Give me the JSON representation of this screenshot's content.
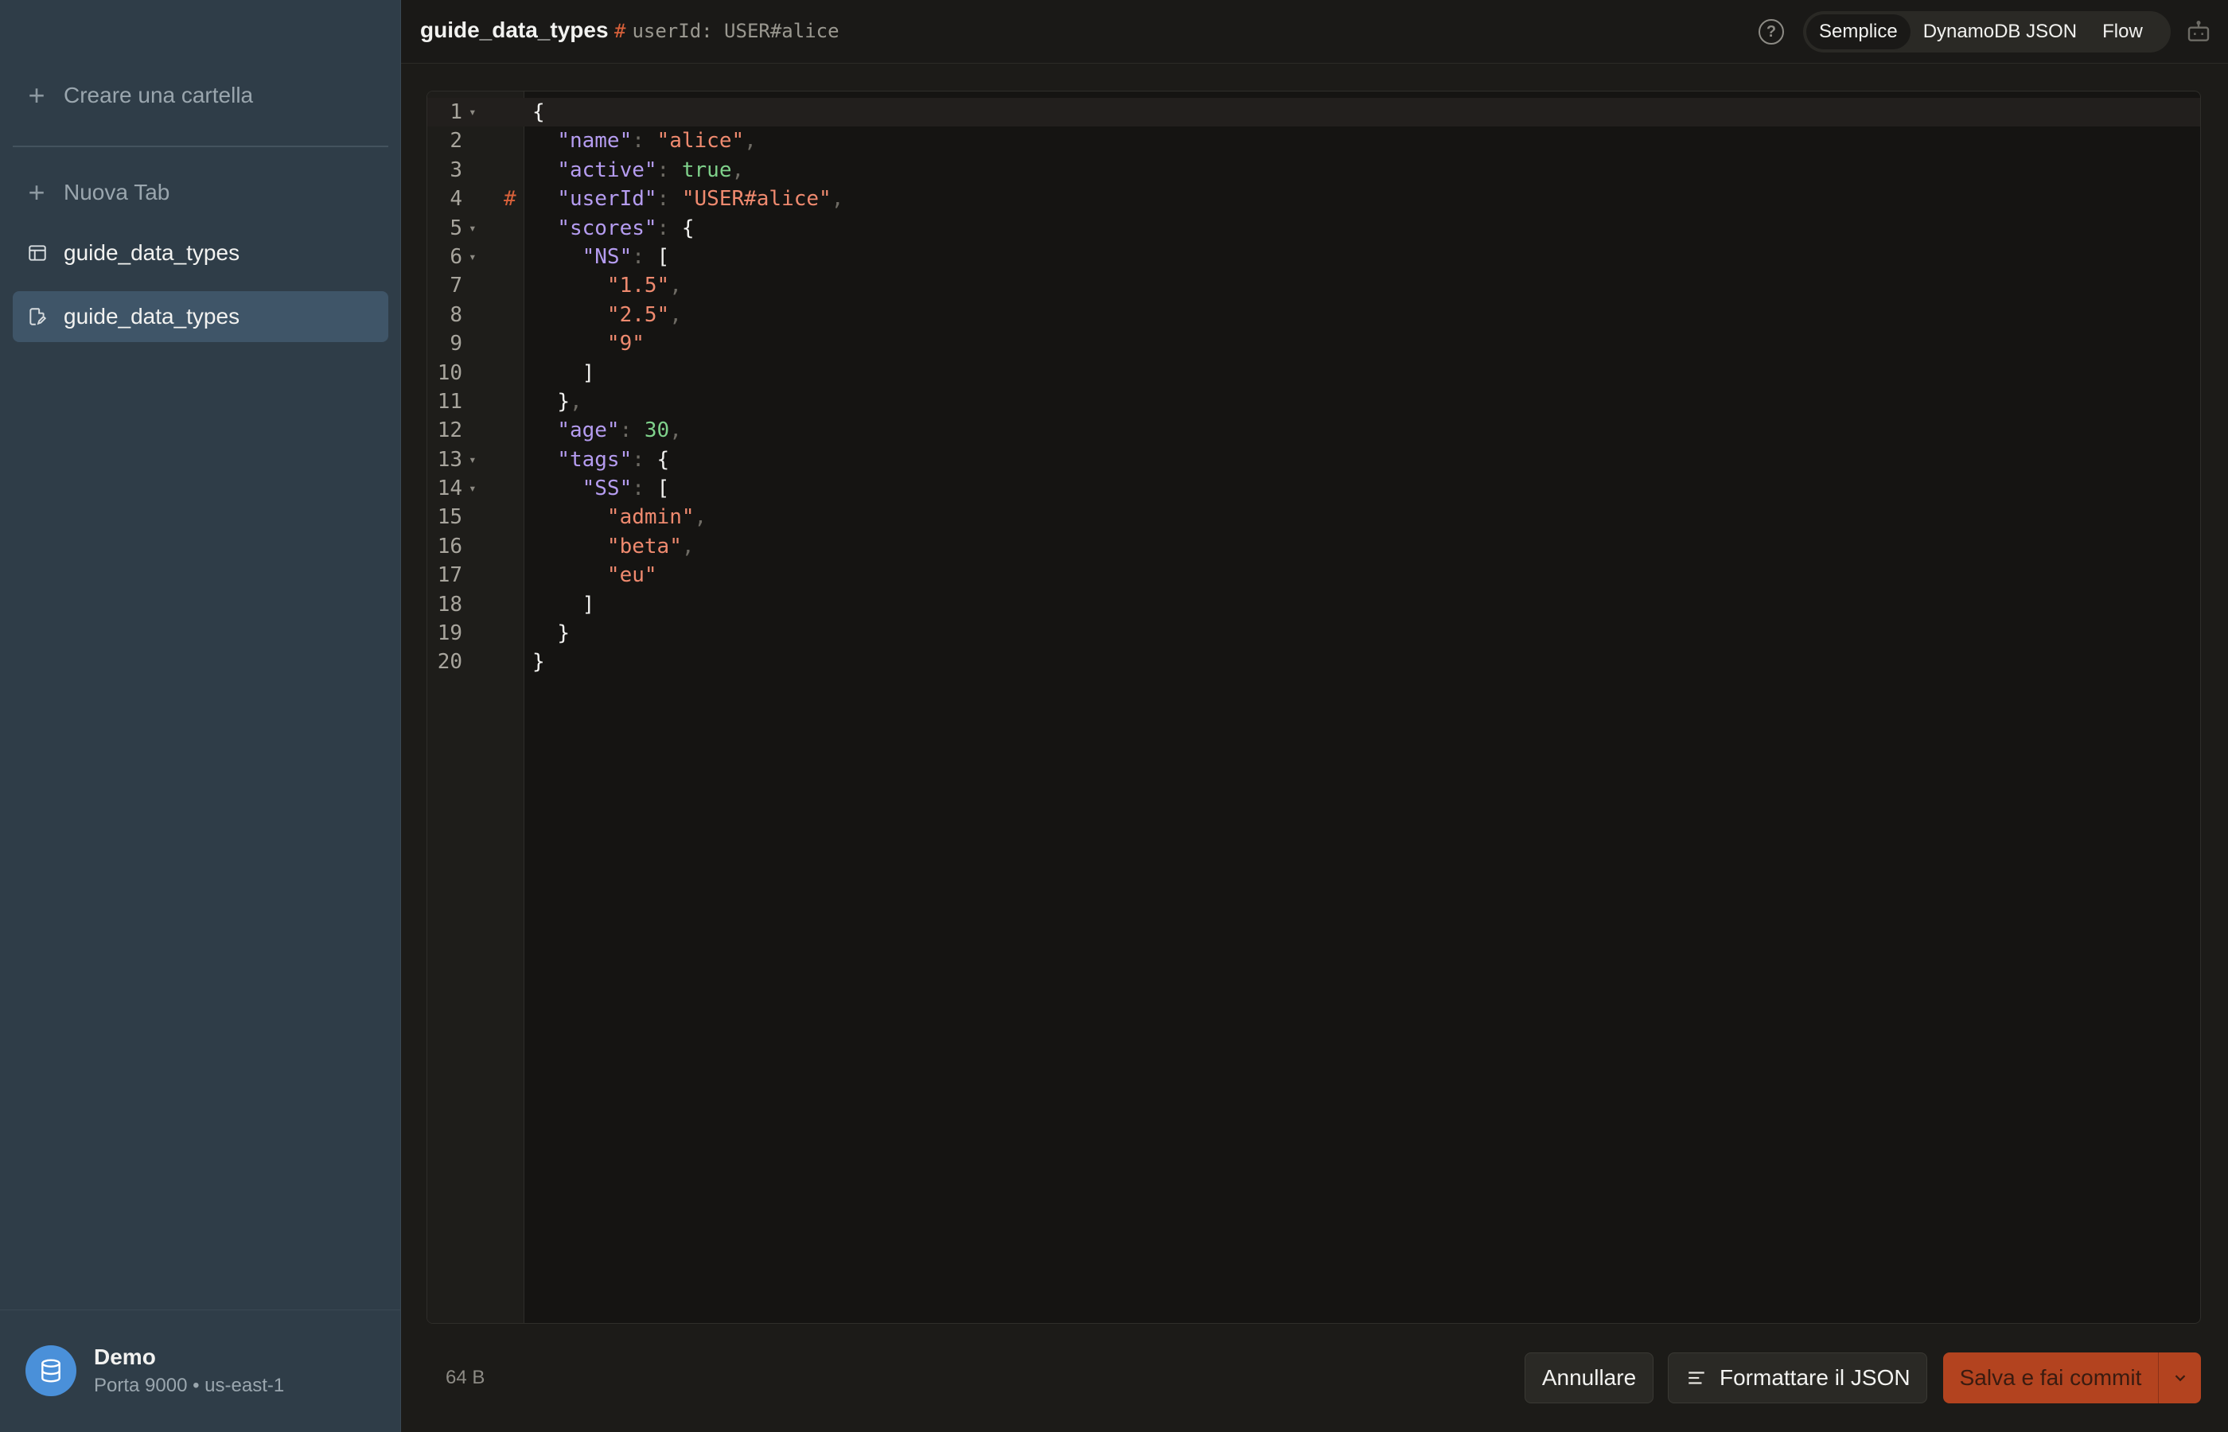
{
  "sidebar": {
    "create_folder": "Creare una cartella",
    "new_tab": "Nuova Tab",
    "items": [
      {
        "label": "guide_data_types",
        "icon": "table-icon",
        "active": false
      },
      {
        "label": "guide_data_types",
        "icon": "document-edit-icon",
        "active": true
      }
    ],
    "user": {
      "name": "Demo",
      "subtitle": "Porta 9000 • us-east-1",
      "icon": "database-icon"
    }
  },
  "header": {
    "title": "guide_data_types",
    "key_hash": "#",
    "key_label": "userId: USER#alice",
    "help": "?",
    "view_modes": [
      "Semplice",
      "DynamoDB JSON",
      "Flow"
    ],
    "selected_view": "Semplice"
  },
  "editor": {
    "lines": [
      {
        "n": "1",
        "fold": "▾",
        "mark": "",
        "tokens": [
          {
            "t": "{",
            "c": "p"
          }
        ]
      },
      {
        "n": "2",
        "fold": "",
        "mark": "",
        "tokens": [
          {
            "t": "  ",
            "c": "p"
          },
          {
            "t": "\"name\"",
            "c": "k"
          },
          {
            "t": ": ",
            "c": "pu"
          },
          {
            "t": "\"alice\"",
            "c": "s"
          },
          {
            "t": ",",
            "c": "pu"
          }
        ]
      },
      {
        "n": "3",
        "fold": "",
        "mark": "",
        "tokens": [
          {
            "t": "  ",
            "c": "p"
          },
          {
            "t": "\"active\"",
            "c": "k"
          },
          {
            "t": ": ",
            "c": "pu"
          },
          {
            "t": "true",
            "c": "b"
          },
          {
            "t": ",",
            "c": "pu"
          }
        ]
      },
      {
        "n": "4",
        "fold": "",
        "mark": "#",
        "tokens": [
          {
            "t": "  ",
            "c": "p"
          },
          {
            "t": "\"userId\"",
            "c": "k"
          },
          {
            "t": ": ",
            "c": "pu"
          },
          {
            "t": "\"USER#alice\"",
            "c": "s"
          },
          {
            "t": ",",
            "c": "pu"
          }
        ]
      },
      {
        "n": "5",
        "fold": "▾",
        "mark": "",
        "tokens": [
          {
            "t": "  ",
            "c": "p"
          },
          {
            "t": "\"scores\"",
            "c": "k"
          },
          {
            "t": ": ",
            "c": "pu"
          },
          {
            "t": "{",
            "c": "p"
          }
        ]
      },
      {
        "n": "6",
        "fold": "▾",
        "mark": "",
        "tokens": [
          {
            "t": "    ",
            "c": "p"
          },
          {
            "t": "\"NS\"",
            "c": "k"
          },
          {
            "t": ": ",
            "c": "pu"
          },
          {
            "t": "[",
            "c": "p"
          }
        ]
      },
      {
        "n": "7",
        "fold": "",
        "mark": "",
        "tokens": [
          {
            "t": "      ",
            "c": "p"
          },
          {
            "t": "\"1.5\"",
            "c": "s"
          },
          {
            "t": ",",
            "c": "pu"
          }
        ]
      },
      {
        "n": "8",
        "fold": "",
        "mark": "",
        "tokens": [
          {
            "t": "      ",
            "c": "p"
          },
          {
            "t": "\"2.5\"",
            "c": "s"
          },
          {
            "t": ",",
            "c": "pu"
          }
        ]
      },
      {
        "n": "9",
        "fold": "",
        "mark": "",
        "tokens": [
          {
            "t": "      ",
            "c": "p"
          },
          {
            "t": "\"9\"",
            "c": "s"
          }
        ]
      },
      {
        "n": "10",
        "fold": "",
        "mark": "",
        "tokens": [
          {
            "t": "    ",
            "c": "p"
          },
          {
            "t": "]",
            "c": "p"
          }
        ]
      },
      {
        "n": "11",
        "fold": "",
        "mark": "",
        "tokens": [
          {
            "t": "  ",
            "c": "p"
          },
          {
            "t": "}",
            "c": "p"
          },
          {
            "t": ",",
            "c": "pu"
          }
        ]
      },
      {
        "n": "12",
        "fold": "",
        "mark": "",
        "tokens": [
          {
            "t": "  ",
            "c": "p"
          },
          {
            "t": "\"age\"",
            "c": "k"
          },
          {
            "t": ": ",
            "c": "pu"
          },
          {
            "t": "30",
            "c": "n"
          },
          {
            "t": ",",
            "c": "pu"
          }
        ]
      },
      {
        "n": "13",
        "fold": "▾",
        "mark": "",
        "tokens": [
          {
            "t": "  ",
            "c": "p"
          },
          {
            "t": "\"tags\"",
            "c": "k"
          },
          {
            "t": ": ",
            "c": "pu"
          },
          {
            "t": "{",
            "c": "p"
          }
        ]
      },
      {
        "n": "14",
        "fold": "▾",
        "mark": "",
        "tokens": [
          {
            "t": "    ",
            "c": "p"
          },
          {
            "t": "\"SS\"",
            "c": "k"
          },
          {
            "t": ": ",
            "c": "pu"
          },
          {
            "t": "[",
            "c": "p"
          }
        ]
      },
      {
        "n": "15",
        "fold": "",
        "mark": "",
        "tokens": [
          {
            "t": "      ",
            "c": "p"
          },
          {
            "t": "\"admin\"",
            "c": "s"
          },
          {
            "t": ",",
            "c": "pu"
          }
        ]
      },
      {
        "n": "16",
        "fold": "",
        "mark": "",
        "tokens": [
          {
            "t": "      ",
            "c": "p"
          },
          {
            "t": "\"beta\"",
            "c": "s"
          },
          {
            "t": ",",
            "c": "pu"
          }
        ]
      },
      {
        "n": "17",
        "fold": "",
        "mark": "",
        "tokens": [
          {
            "t": "      ",
            "c": "p"
          },
          {
            "t": "\"eu\"",
            "c": "s"
          }
        ]
      },
      {
        "n": "18",
        "fold": "",
        "mark": "",
        "tokens": [
          {
            "t": "    ",
            "c": "p"
          },
          {
            "t": "]",
            "c": "p"
          }
        ]
      },
      {
        "n": "19",
        "fold": "",
        "mark": "",
        "tokens": [
          {
            "t": "  ",
            "c": "p"
          },
          {
            "t": "}",
            "c": "p"
          }
        ]
      },
      {
        "n": "20",
        "fold": "",
        "mark": "",
        "tokens": [
          {
            "t": "}",
            "c": "p"
          }
        ]
      }
    ]
  },
  "footer": {
    "size": "64 B",
    "cancel": "Annullare",
    "format": "Formattare il JSON",
    "save": "Salva e fai commit"
  },
  "colors": {
    "sidebar_bg": "#2f3d48",
    "active_item": "#3f5568",
    "accent": "#b3431f",
    "json_key": "#b59cf0",
    "json_string": "#ef8a6f",
    "json_literal": "#7fd18b"
  }
}
